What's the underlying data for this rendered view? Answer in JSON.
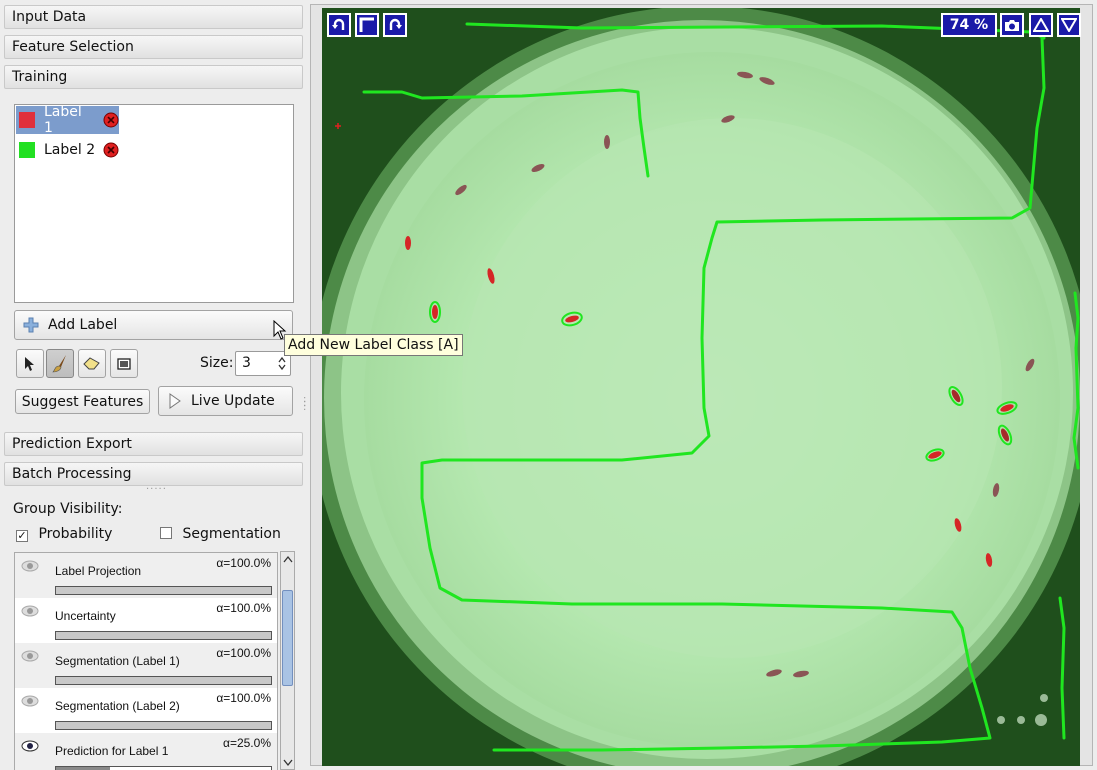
{
  "drawers": {
    "input_data": "Input Data",
    "feature_selection": "Feature Selection",
    "training": "Training",
    "prediction_export": "Prediction Export",
    "batch_processing": "Batch Processing"
  },
  "labels": [
    {
      "name": "Label 1",
      "color": "#e0303c",
      "selected": true
    },
    {
      "name": "Label 2",
      "color": "#22e022",
      "selected": false
    }
  ],
  "add_label": "Add Label",
  "tooltip": "Add New Label Class [A]",
  "tools": {
    "active": "brush",
    "items": [
      "arrow-icon",
      "brush-icon",
      "eraser-icon",
      "swap-icon"
    ]
  },
  "size": {
    "label": "Size:",
    "value": "3"
  },
  "suggest_features": "Suggest Features",
  "live_update": "Live Update",
  "group_visibility": {
    "title": "Group Visibility:",
    "probability": {
      "label": "Probability",
      "checked": true
    },
    "segmentation": {
      "label": "Segmentation",
      "checked": false
    }
  },
  "layers": [
    {
      "name": "Label Projection",
      "alpha": "α=100.0%",
      "opacity": 1.0
    },
    {
      "name": "Uncertainty",
      "alpha": "α=100.0%",
      "opacity": 1.0
    },
    {
      "name": "Segmentation (Label 1)",
      "alpha": "α=100.0%",
      "opacity": 1.0
    },
    {
      "name": "Segmentation (Label 2)",
      "alpha": "α=100.0%",
      "opacity": 1.0
    },
    {
      "name": "Prediction for Label 1",
      "alpha": "α=25.0%",
      "opacity": 0.25
    }
  ],
  "viewer": {
    "zoom": "74 %"
  },
  "colors": {
    "accent_blue": "#1a1aa8",
    "label_red": "#e0303c",
    "label_green": "#22e022",
    "selection": "#7c9ccc"
  }
}
